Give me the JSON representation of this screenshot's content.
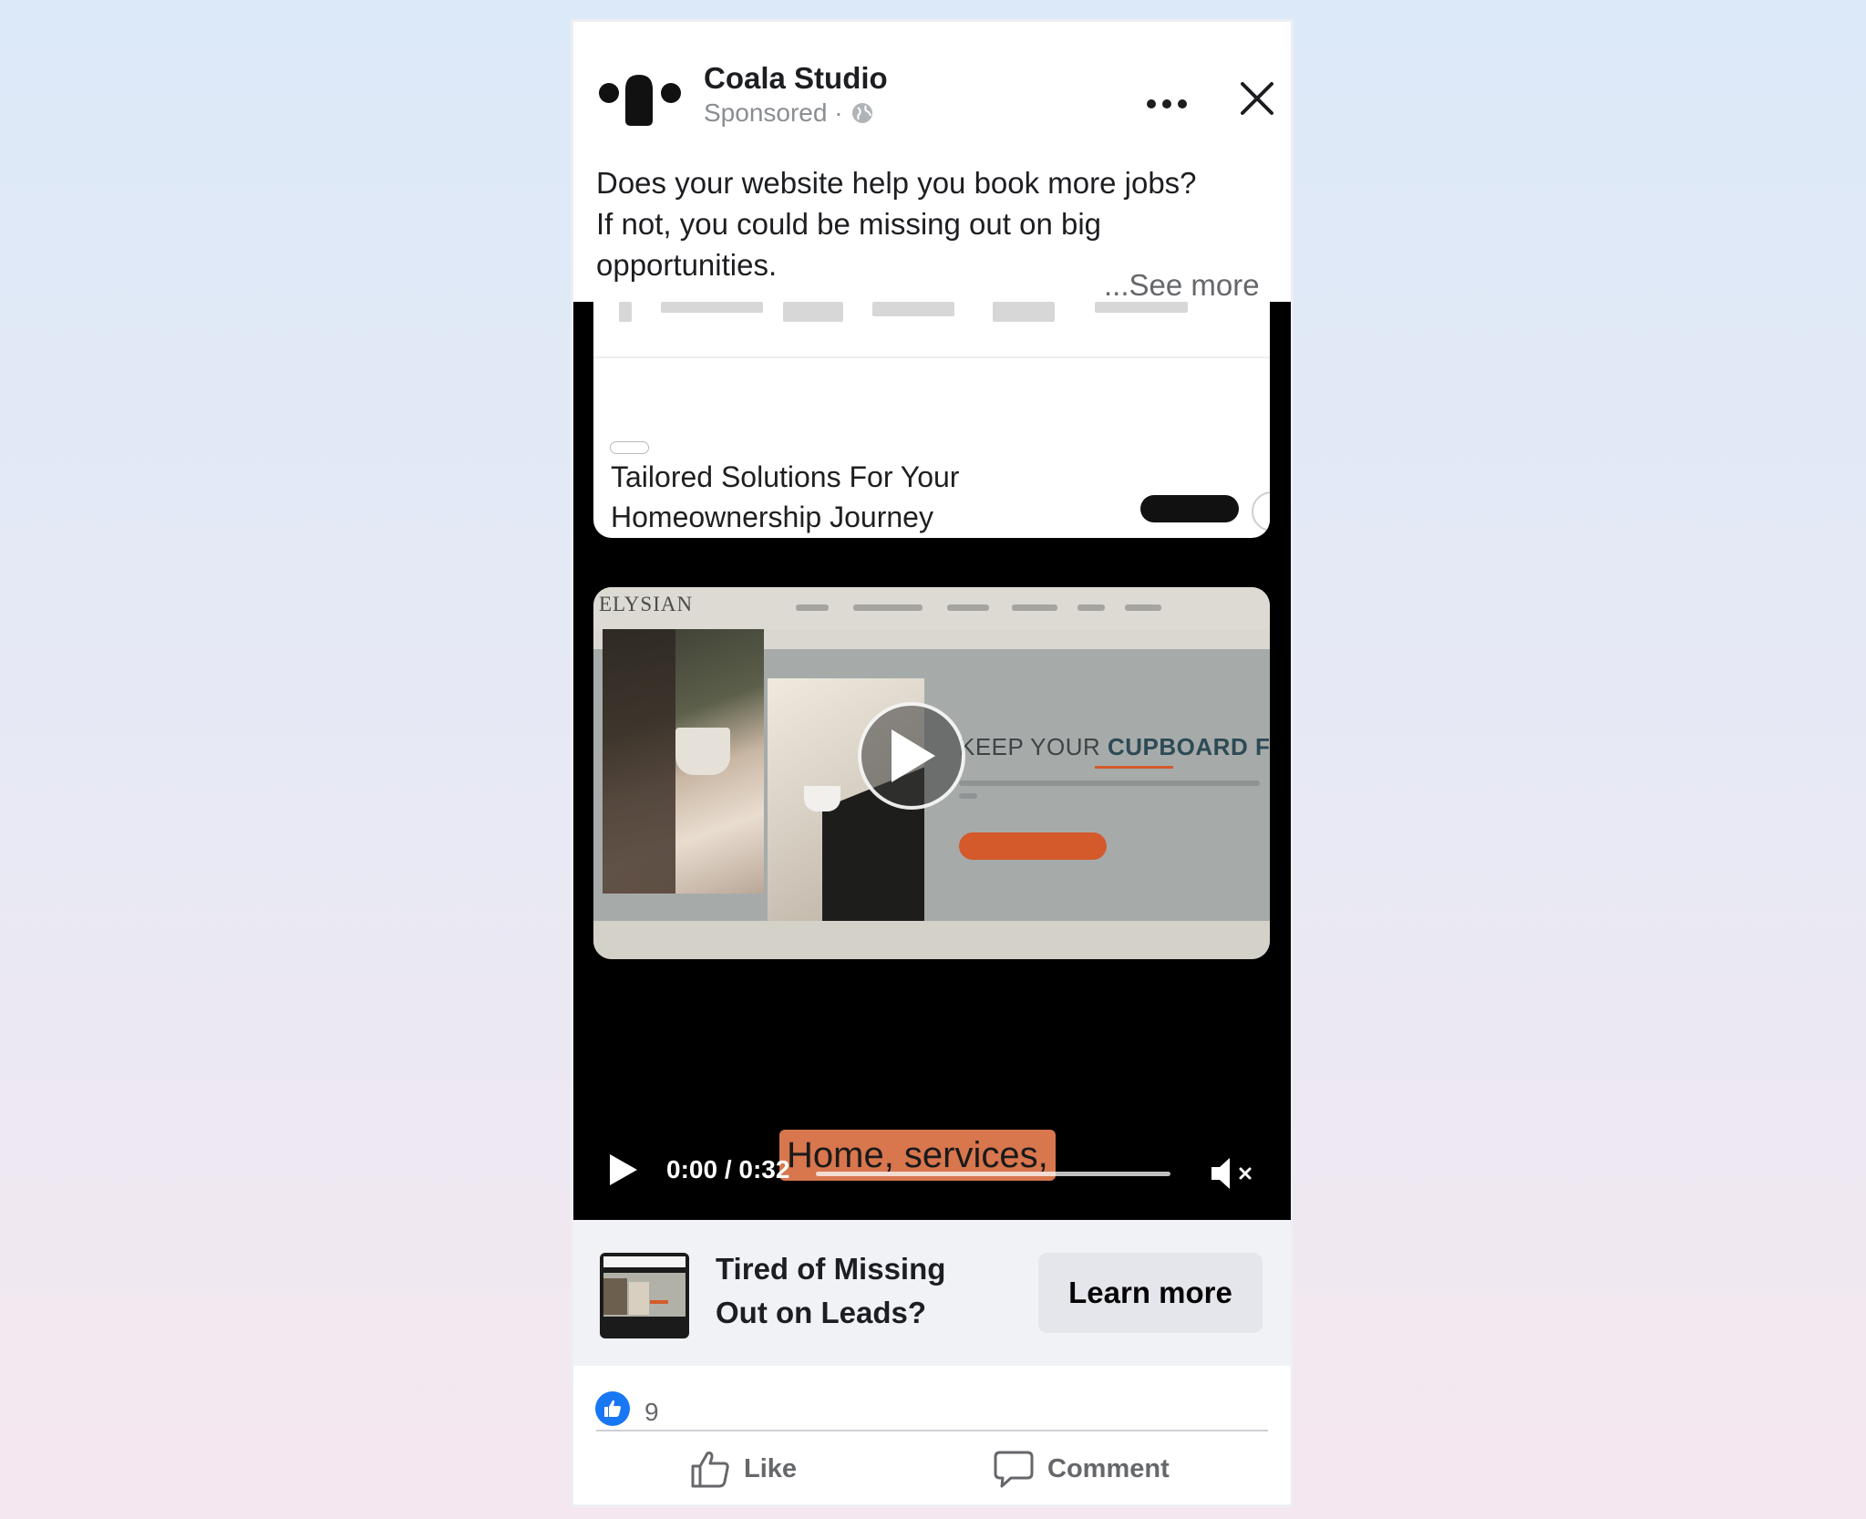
{
  "post": {
    "page_name": "Coala Studio",
    "sponsored_label": "Sponsored ·",
    "caption_lines": [
      "Does your website help you book more jobs?",
      "If not, you could be missing out on big",
      "opportunities."
    ],
    "see_more": "...See more"
  },
  "video": {
    "frame_top": {
      "headline_lines": [
        "Tailored Solutions For Your",
        "Homeownership Journey"
      ]
    },
    "frame_main": {
      "site_brand": "ELYSIAN",
      "hero_title_prefix": "KEEP YOUR ",
      "hero_title_emphasis": "CUPBOARD FUL"
    },
    "subtitle": "Home, services,",
    "controls": {
      "time": "0:00 / 0:32",
      "progress": 0.0,
      "muted": true
    }
  },
  "link": {
    "title_lines": [
      "Tired of Missing",
      "Out on Leads?"
    ],
    "cta": "Learn more"
  },
  "footer": {
    "reaction_count": "9",
    "like_label": "Like",
    "comment_label": "Comment"
  },
  "colors": {
    "brand_blue": "#1877f2",
    "subtitle_bg": "#d8764e",
    "hero_accent": "#d45a2b"
  },
  "icons": [
    "coala-logo-icon",
    "globe-icon",
    "more-options-icon",
    "close-icon",
    "play-icon",
    "mute-icon",
    "like-reaction-icon",
    "thumbs-up-icon",
    "comment-icon"
  ]
}
